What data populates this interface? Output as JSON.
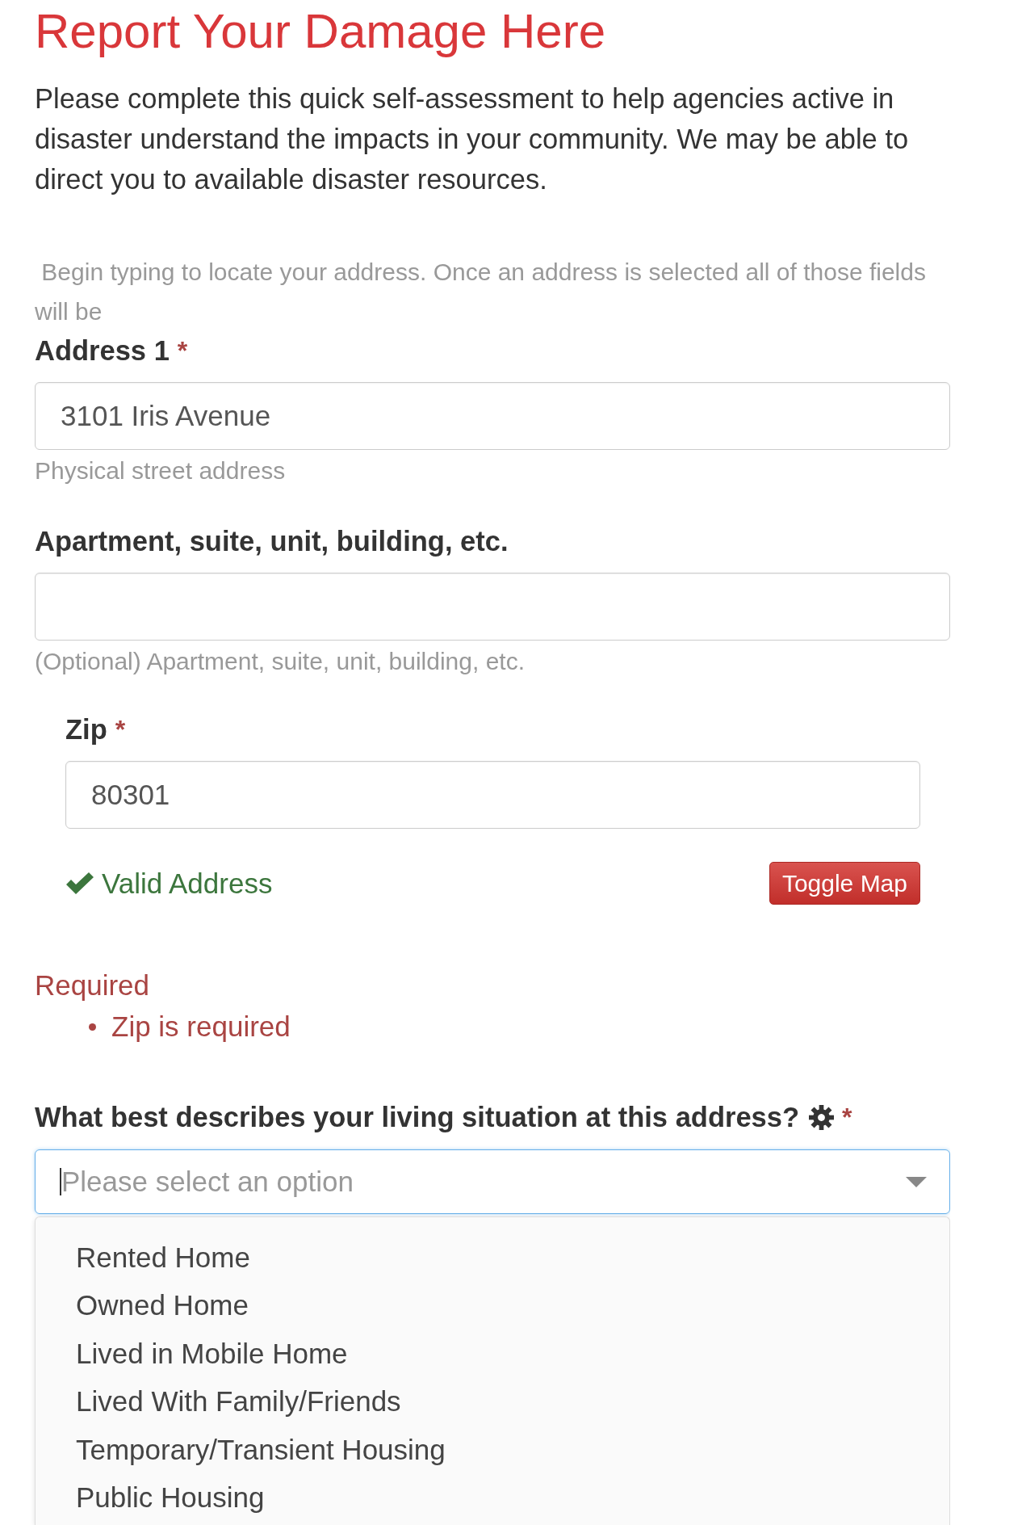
{
  "title": "Report Your Damage Here",
  "intro": "Please complete this quick self-assessment to help agencies active in disaster understand the impacts in your community. We may be able to direct you to available disaster resources.",
  "hint": " Begin typing to locate your address. Once an address is selected all of those fields will be",
  "address_fields": [
    {
      "label": "Address 1",
      "required_mark": "*",
      "value": "3101 Iris Avenue",
      "help": "Physical street address"
    },
    {
      "label": "Apartment, suite, unit, building, etc.",
      "help": "(Optional) Apartment, suite, unit, building, etc."
    }
  ],
  "zip": {
    "label": "Zip",
    "required_mark": "*",
    "value": "80301",
    "validation": {
      "text": "Valid Address",
      "valid": true
    },
    "toggle_button": "Toggle Map"
  },
  "errors": {
    "title": "Required",
    "items": [
      "Zip is required"
    ]
  },
  "living_situation": {
    "label": "What best describes your living situation at this address?",
    "required_mark": "*",
    "placeholder": "Please select an option",
    "expanded": true,
    "options": [
      {
        "label": "Rented Home",
        "selected": false
      },
      {
        "label": "Owned Home",
        "selected": false
      },
      {
        "label": "Lived in Mobile Home",
        "selected": false
      },
      {
        "label": "Lived With Family/Friends",
        "selected": false
      },
      {
        "label": "Temporary/Transient Housing",
        "selected": false
      },
      {
        "label": "Public Housing",
        "selected": false
      }
    ]
  }
}
